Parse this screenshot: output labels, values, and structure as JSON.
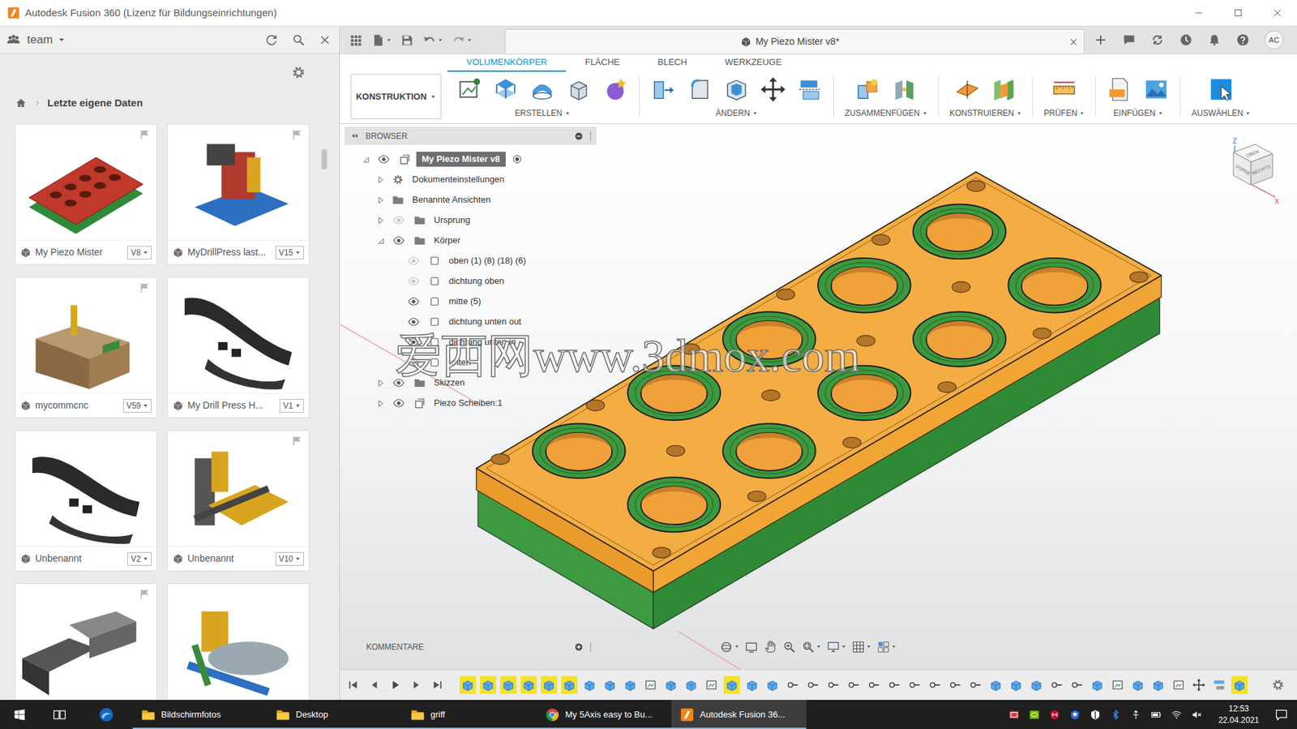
{
  "window": {
    "title": "Autodesk Fusion 360 (Lizenz für Bildungseinrichtungen)"
  },
  "data_panel": {
    "team": "team",
    "breadcrumb": "Letzte eigene Daten",
    "files": [
      {
        "name": "My Piezo Mister",
        "version": "V8",
        "pinned": true
      },
      {
        "name": "MyDrillPress last...",
        "version": "V15",
        "pinned": true
      },
      {
        "name": "mycommcnc",
        "version": "V59",
        "pinned": true
      },
      {
        "name": "My Drill Press H...",
        "version": "V1",
        "pinned": false
      },
      {
        "name": "Unbenannt",
        "version": "V2",
        "pinned": false
      },
      {
        "name": "Unbenannt",
        "version": "V10",
        "pinned": true
      },
      {
        "pinned": true
      },
      {
        "pinned": false
      }
    ]
  },
  "document": {
    "tab": "My Piezo Mister v8*",
    "user": "AC"
  },
  "ribbon": {
    "tabs": [
      {
        "label": "VOLUMENKÖRPER",
        "selected": true
      },
      {
        "label": "FLÄCHE",
        "selected": false
      },
      {
        "label": "BLECH",
        "selected": false
      },
      {
        "label": "WERKZEUGE",
        "selected": false
      }
    ],
    "workspace": "KONSTRUKTION",
    "groups": [
      "ERSTELLEN",
      "ÄNDERN",
      "ZUSAMMENFÜGEN",
      "KONSTRUIEREN",
      "PRÜFEN",
      "EINFÜGEN",
      "AUSWÄHLEN"
    ]
  },
  "browser": {
    "title": "BROWSER",
    "items": [
      {
        "label": "My Piezo Mister v8",
        "depth": 0,
        "kind": "root",
        "expanded": true,
        "visible": true,
        "active": true
      },
      {
        "label": "Dokumenteinstellungen",
        "depth": 1,
        "kind": "settings",
        "expanded": false
      },
      {
        "label": "Benannte Ansichten",
        "depth": 1,
        "kind": "folder",
        "expanded": false
      },
      {
        "label": "Ursprung",
        "depth": 1,
        "kind": "folder",
        "expanded": false,
        "visible": false
      },
      {
        "label": "Körper",
        "depth": 1,
        "kind": "folder",
        "expanded": true,
        "visible": true
      },
      {
        "label": "oben (1) (8) (18) (6)",
        "depth": 2,
        "kind": "body",
        "visible": false
      },
      {
        "label": "dichtung oben",
        "depth": 2,
        "kind": "body",
        "visible": false
      },
      {
        "label": "mitte (5)",
        "depth": 2,
        "kind": "body",
        "visible": true
      },
      {
        "label": "dichtung unten out",
        "depth": 2,
        "kind": "body",
        "visible": true
      },
      {
        "label": "dichtung unten in",
        "depth": 2,
        "kind": "body",
        "visible": true
      },
      {
        "label": "unten",
        "depth": 2,
        "kind": "body",
        "visible": true
      },
      {
        "label": "Skizzen",
        "depth": 1,
        "kind": "folder",
        "expanded": false,
        "visible": true
      },
      {
        "label": "Piezo Scheiben:1",
        "depth": 1,
        "kind": "component",
        "expanded": false,
        "visible": true
      }
    ]
  },
  "viewcube": {
    "top": "OBEN",
    "front": "VORNE",
    "right": "RECHTS",
    "z": "Z",
    "x": "X"
  },
  "watermark": "爱西网www.3dmox.com",
  "comments": {
    "title": "KOMMENTARE"
  },
  "timeline": {
    "features": [
      {
        "kind": "extrude",
        "highlighted": true
      },
      {
        "kind": "extrude",
        "highlighted": true
      },
      {
        "kind": "extrude",
        "highlighted": true
      },
      {
        "kind": "extrude",
        "highlighted": true
      },
      {
        "kind": "extrude",
        "highlighted": true
      },
      {
        "kind": "extrude",
        "highlighted": true
      },
      {
        "kind": "extrude",
        "highlighted": false
      },
      {
        "kind": "extrude",
        "highlighted": false
      },
      {
        "kind": "extrude",
        "highlighted": false
      },
      {
        "kind": "sketch",
        "highlighted": false
      },
      {
        "kind": "extrude",
        "highlighted": false
      },
      {
        "kind": "extrude",
        "highlighted": false
      },
      {
        "kind": "sketch",
        "highlighted": false
      },
      {
        "kind": "extrude",
        "highlighted": true
      },
      {
        "kind": "extrude",
        "highlighted": false
      },
      {
        "kind": "extrude",
        "highlighted": false
      },
      {
        "kind": "hole",
        "highlighted": false
      },
      {
        "kind": "hole",
        "highlighted": false
      },
      {
        "kind": "hole",
        "highlighted": false
      },
      {
        "kind": "hole",
        "highlighted": false
      },
      {
        "kind": "hole",
        "highlighted": false
      },
      {
        "kind": "hole",
        "highlighted": false
      },
      {
        "kind": "hole",
        "highlighted": false
      },
      {
        "kind": "hole",
        "highlighted": false
      },
      {
        "kind": "hole",
        "highlighted": false
      },
      {
        "kind": "hole",
        "highlighted": false
      },
      {
        "kind": "extrude",
        "highlighted": false
      },
      {
        "kind": "extrude",
        "highlighted": false
      },
      {
        "kind": "extrude",
        "highlighted": false
      },
      {
        "kind": "hole",
        "highlighted": false
      },
      {
        "kind": "hole",
        "highlighted": false
      },
      {
        "kind": "extrude",
        "highlighted": false
      },
      {
        "kind": "sketch",
        "highlighted": false
      },
      {
        "kind": "extrude",
        "highlighted": false
      },
      {
        "kind": "extrude",
        "highlighted": false
      },
      {
        "kind": "sketch",
        "highlighted": false
      },
      {
        "kind": "move",
        "highlighted": false
      },
      {
        "kind": "align",
        "highlighted": false
      },
      {
        "kind": "extrude",
        "highlighted": true
      }
    ]
  },
  "taskbar": {
    "apps": [
      {
        "label": "Bildschirmfotos",
        "kind": "folder",
        "selected": false
      },
      {
        "label": "Desktop",
        "kind": "folder",
        "selected": false
      },
      {
        "label": "griff",
        "kind": "folder",
        "selected": false
      },
      {
        "label": "My 5Axis easy to Bu...",
        "kind": "chrome",
        "selected": false
      },
      {
        "label": "Autodesk Fusion 36...",
        "kind": "fusion",
        "selected": true
      }
    ],
    "time": "12:53",
    "date": "22.04.2021"
  }
}
